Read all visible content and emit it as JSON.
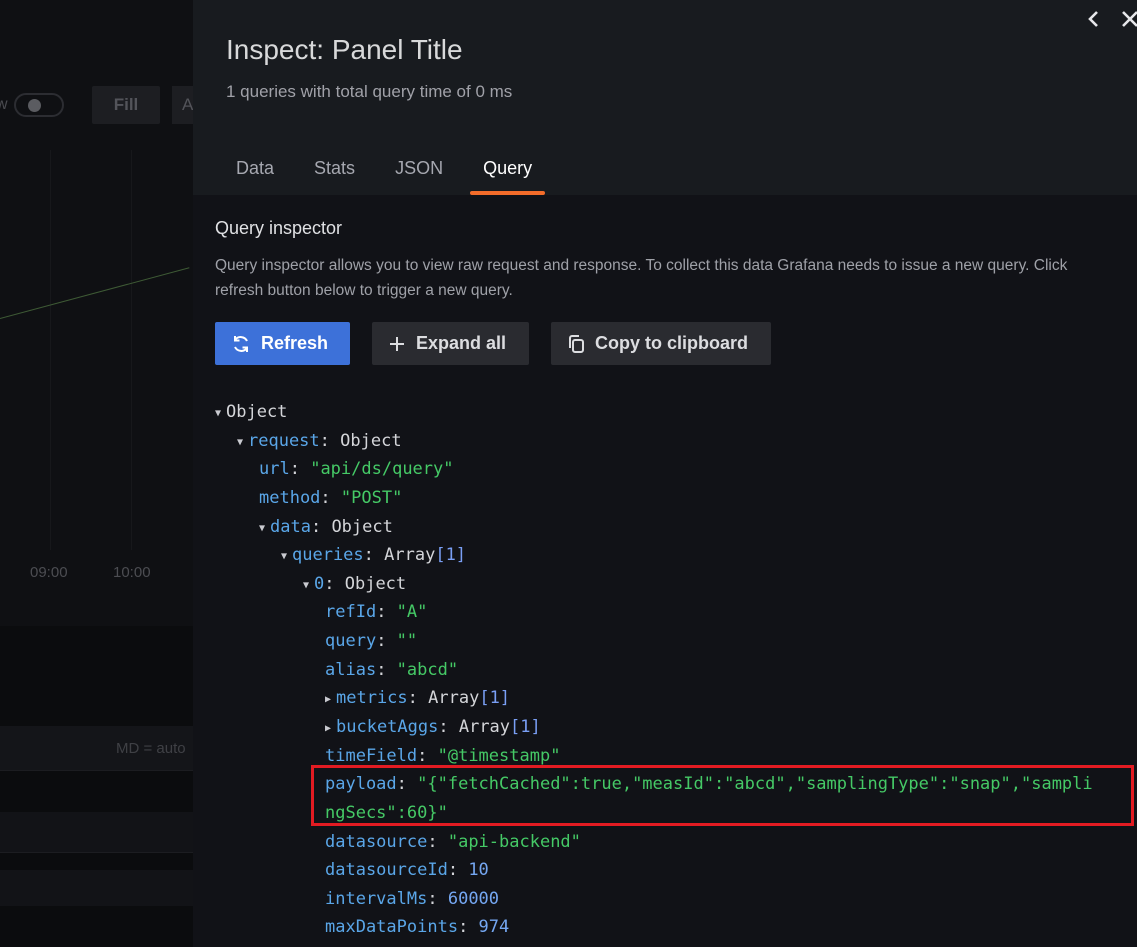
{
  "background": {
    "toggle_label": "w",
    "fill_button": "Fill",
    "a_button": "A",
    "x_ticks": [
      "09:00",
      "10:00"
    ],
    "legend_text": "MD = auto"
  },
  "inspect": {
    "title": "Inspect: Panel Title",
    "subtitle": "1 queries with total query time of 0 ms",
    "tabs": [
      {
        "label": "Data",
        "active": false
      },
      {
        "label": "Stats",
        "active": false
      },
      {
        "label": "JSON",
        "active": false
      },
      {
        "label": "Query",
        "active": true
      }
    ],
    "section_title": "Query inspector",
    "description": "Query inspector allows you to view raw request and response. To collect this data Grafana needs to issue a new query. Click refresh button below to trigger a new query.",
    "buttons": {
      "refresh": "Refresh",
      "expand_all": "Expand all",
      "copy": "Copy to clipboard"
    },
    "icons": {
      "collapse": "chevron-left-icon",
      "close": "close-icon",
      "refresh": "sync-icon",
      "expand": "plus-icon",
      "copy": "copy-icon"
    },
    "tree": {
      "root": "Object",
      "request_key": "request",
      "request_val": "Object",
      "url_key": "url",
      "url_val": "\"api/ds/query\"",
      "method_key": "method",
      "method_val": "\"POST\"",
      "data_key": "data",
      "data_val": "Object",
      "queries_key": "queries",
      "queries_val": "Array",
      "queries_len": "[1]",
      "q0_key": "0",
      "q0_val": "Object",
      "refId_key": "refId",
      "refId_val": "\"A\"",
      "query_key": "query",
      "query_val": "\"\"",
      "alias_key": "alias",
      "alias_val": "\"abcd\"",
      "metrics_key": "metrics",
      "metrics_val": "Array",
      "metrics_len": "[1]",
      "bucketAggs_key": "bucketAggs",
      "bucketAggs_val": "Array",
      "bucketAggs_len": "[1]",
      "timeField_key": "timeField",
      "timeField_val": "\"@timestamp\"",
      "payload_key": "payload",
      "payload_val_line1": "\"{\"fetchCached\":true,\"measId\":\"abcd\",\"samplingType\":\"snap\",\"sampli",
      "payload_val_line2": "ngSecs\":60}\"",
      "datasource_key": "datasource",
      "datasource_val": "\"api-backend\"",
      "datasourceId_key": "datasourceId",
      "datasourceId_val": "10",
      "intervalMs_key": "intervalMs",
      "intervalMs_val": "60000",
      "maxDataPoints_key": "maxDataPoints",
      "maxDataPoints_val": "974"
    },
    "colors": {
      "accent_tab": "#f36c2a",
      "primary_button": "#3d71d9",
      "highlight_box": "#e21b22",
      "json_key": "#5aa6e8",
      "json_string": "#45c966"
    }
  }
}
